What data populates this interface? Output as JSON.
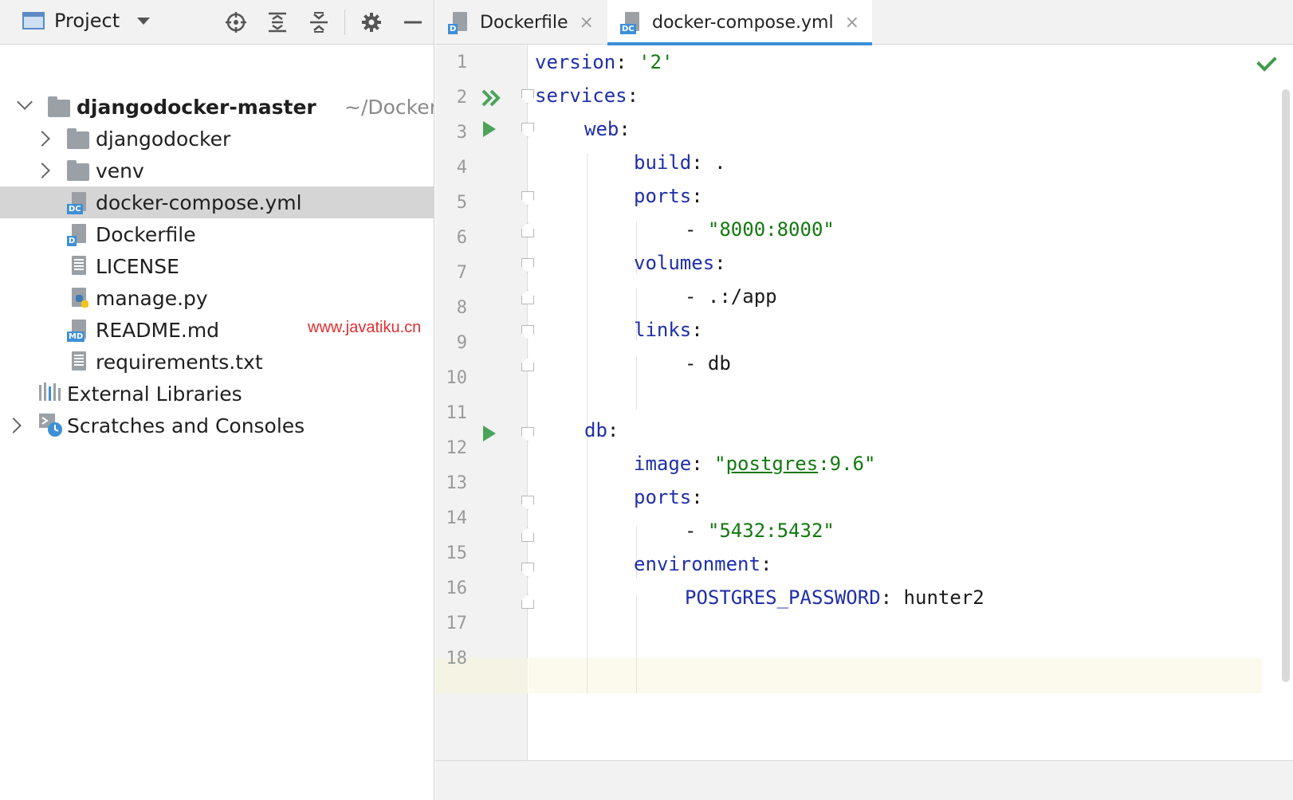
{
  "project_panel": {
    "title": "Project",
    "toolbar_icons": [
      "locate-icon",
      "expand-all-icon",
      "collapse-all-icon",
      "gear-icon",
      "minimize-icon"
    ],
    "tree": {
      "root": {
        "name": "djangodocker-master",
        "path": "~/Docker"
      },
      "items": [
        {
          "label": "djangodocker",
          "type": "folder",
          "icon": "folder-icon"
        },
        {
          "label": "venv",
          "type": "folder",
          "icon": "folder-icon"
        },
        {
          "label": "docker-compose.yml",
          "type": "file",
          "icon": "docker-compose-file-icon",
          "badge": "DC"
        },
        {
          "label": "Dockerfile",
          "type": "file",
          "icon": "dockerfile-icon",
          "badge": "D"
        },
        {
          "label": "LICENSE",
          "type": "file",
          "icon": "text-file-icon"
        },
        {
          "label": "manage.py",
          "type": "file",
          "icon": "python-file-icon"
        },
        {
          "label": "README.md",
          "type": "file",
          "icon": "markdown-file-icon",
          "badge": "MD"
        },
        {
          "label": "requirements.txt",
          "type": "file",
          "icon": "text-file-icon"
        }
      ],
      "external_libraries": "External Libraries",
      "scratches": "Scratches and Consoles"
    }
  },
  "watermark": "www.javatiku.cn",
  "editor": {
    "tabs": [
      {
        "label": "Dockerfile",
        "badge": "D",
        "active": false
      },
      {
        "label": "docker-compose.yml",
        "badge": "DC",
        "active": true
      }
    ],
    "close_glyph": "×",
    "line_numbers": [
      "1",
      "2",
      "3",
      "4",
      "5",
      "6",
      "7",
      "8",
      "9",
      "10",
      "11",
      "12",
      "13",
      "14",
      "15",
      "16",
      "17",
      "18"
    ],
    "code": {
      "l1": {
        "key": "version",
        "sep": ": ",
        "val": "'2'"
      },
      "l2": {
        "key": "services",
        "sep": ":"
      },
      "l3": {
        "key": "web",
        "sep": ":"
      },
      "l4": {
        "key": "build",
        "sep": ": ",
        "val": "."
      },
      "l5": {
        "key": "ports",
        "sep": ":"
      },
      "l6": {
        "dash": "- ",
        "val": "\"8000:8000\""
      },
      "l7": {
        "key": "volumes",
        "sep": ":"
      },
      "l8": {
        "dash": "- ",
        "val": ".:/app"
      },
      "l9": {
        "key": "links",
        "sep": ":"
      },
      "l10": {
        "dash": "- ",
        "val": "db"
      },
      "l12": {
        "key": "db",
        "sep": ":"
      },
      "l13": {
        "key": "image",
        "sep": ": ",
        "q1": "\"",
        "link": "postgres",
        "rest": ":9.6\""
      },
      "l14": {
        "key": "ports",
        "sep": ":"
      },
      "l15": {
        "dash": "- ",
        "val": "\"5432:5432\""
      },
      "l16": {
        "key": "environment",
        "sep": ":"
      },
      "l17": {
        "key": "POSTGRES_PASSWORD",
        "sep": ": ",
        "val": "hunter2"
      }
    },
    "colors": {
      "key": "#1f2fa8",
      "string": "#13790f",
      "run": "#4aa35a",
      "accent": "#3d8fd6"
    }
  }
}
